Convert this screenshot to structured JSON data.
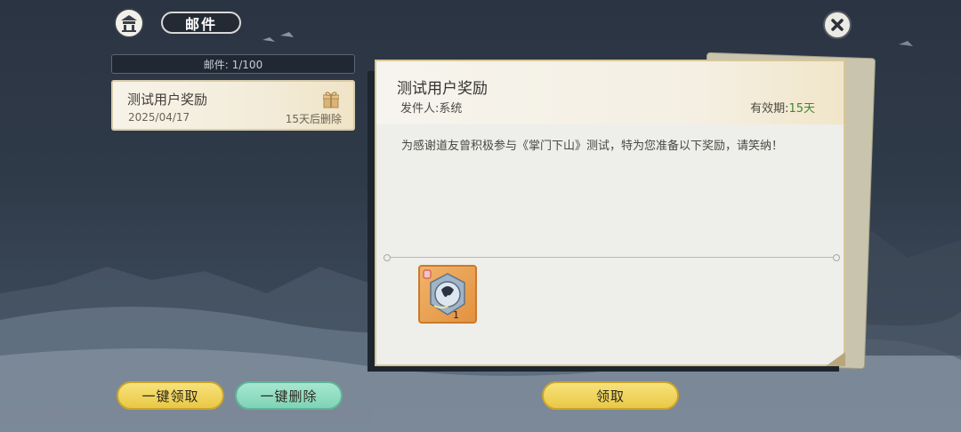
{
  "header": {
    "title": "邮件",
    "home_icon": "pavilion-icon",
    "close_icon": "close-icon"
  },
  "mail_list": {
    "count_text": "邮件: 1/100",
    "items": [
      {
        "title": "测试用户奖励",
        "date": "2025/04/17",
        "expire_text": "15天后删除",
        "icon": "gift-icon"
      }
    ]
  },
  "detail": {
    "title": "测试用户奖励",
    "sender": "发件人:系统",
    "validity_label": "有效期:",
    "validity_value": "15天",
    "body": "为感谢道友曾积极参与《掌门下山》测试，特为您准备以下奖励，请笑纳！",
    "rewards": [
      {
        "icon": "mirror-artifact-icon",
        "count": "1"
      }
    ]
  },
  "buttons": {
    "claim_all": "一键领取",
    "delete_all": "一键删除",
    "claim": "领取"
  },
  "colors": {
    "accent_yellow": "#f7e27a",
    "accent_teal": "#a6e7d0",
    "validity_green": "#3f8a2c"
  }
}
